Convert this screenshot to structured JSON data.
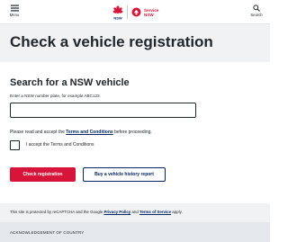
{
  "header": {
    "menu_label": "Menu",
    "search_label": "Search",
    "nsw_logo_text": "NSW",
    "service_nsw_line1": "Service",
    "service_nsw_line2": "NSW"
  },
  "page": {
    "title": "Check a vehicle registration"
  },
  "form": {
    "section_title": "Search for a NSW vehicle",
    "plate_label": "Enter a NSW number plate, for example ABC123.",
    "plate_value": "",
    "terms_prefix": "Please read and accept the ",
    "terms_link": "Terms and Conditions",
    "terms_suffix": " before proceeding.",
    "checkbox_label": "I accept the Terms and Conditions",
    "check_button": "Check registration",
    "history_button": "Buy a vehicle history report"
  },
  "footer": {
    "recaptcha_prefix": "This site is protected by reCAPTCHA and the Google ",
    "privacy_link": "Privacy Policy",
    "recaptcha_and": " and ",
    "tos_link": "Terms of Service",
    "recaptcha_suffix": " apply.",
    "acknowledgement": "ACKNOWLEDGEMENT OF COUNTRY"
  },
  "colors": {
    "brand_red": "#d7153a",
    "brand_navy": "#002664",
    "band_grey": "#f0f2f4"
  },
  "icons": {
    "menu": "hamburger-icon",
    "search": "search-icon",
    "logo": "nsw-waratah-logo",
    "service": "service-nsw-logo"
  }
}
